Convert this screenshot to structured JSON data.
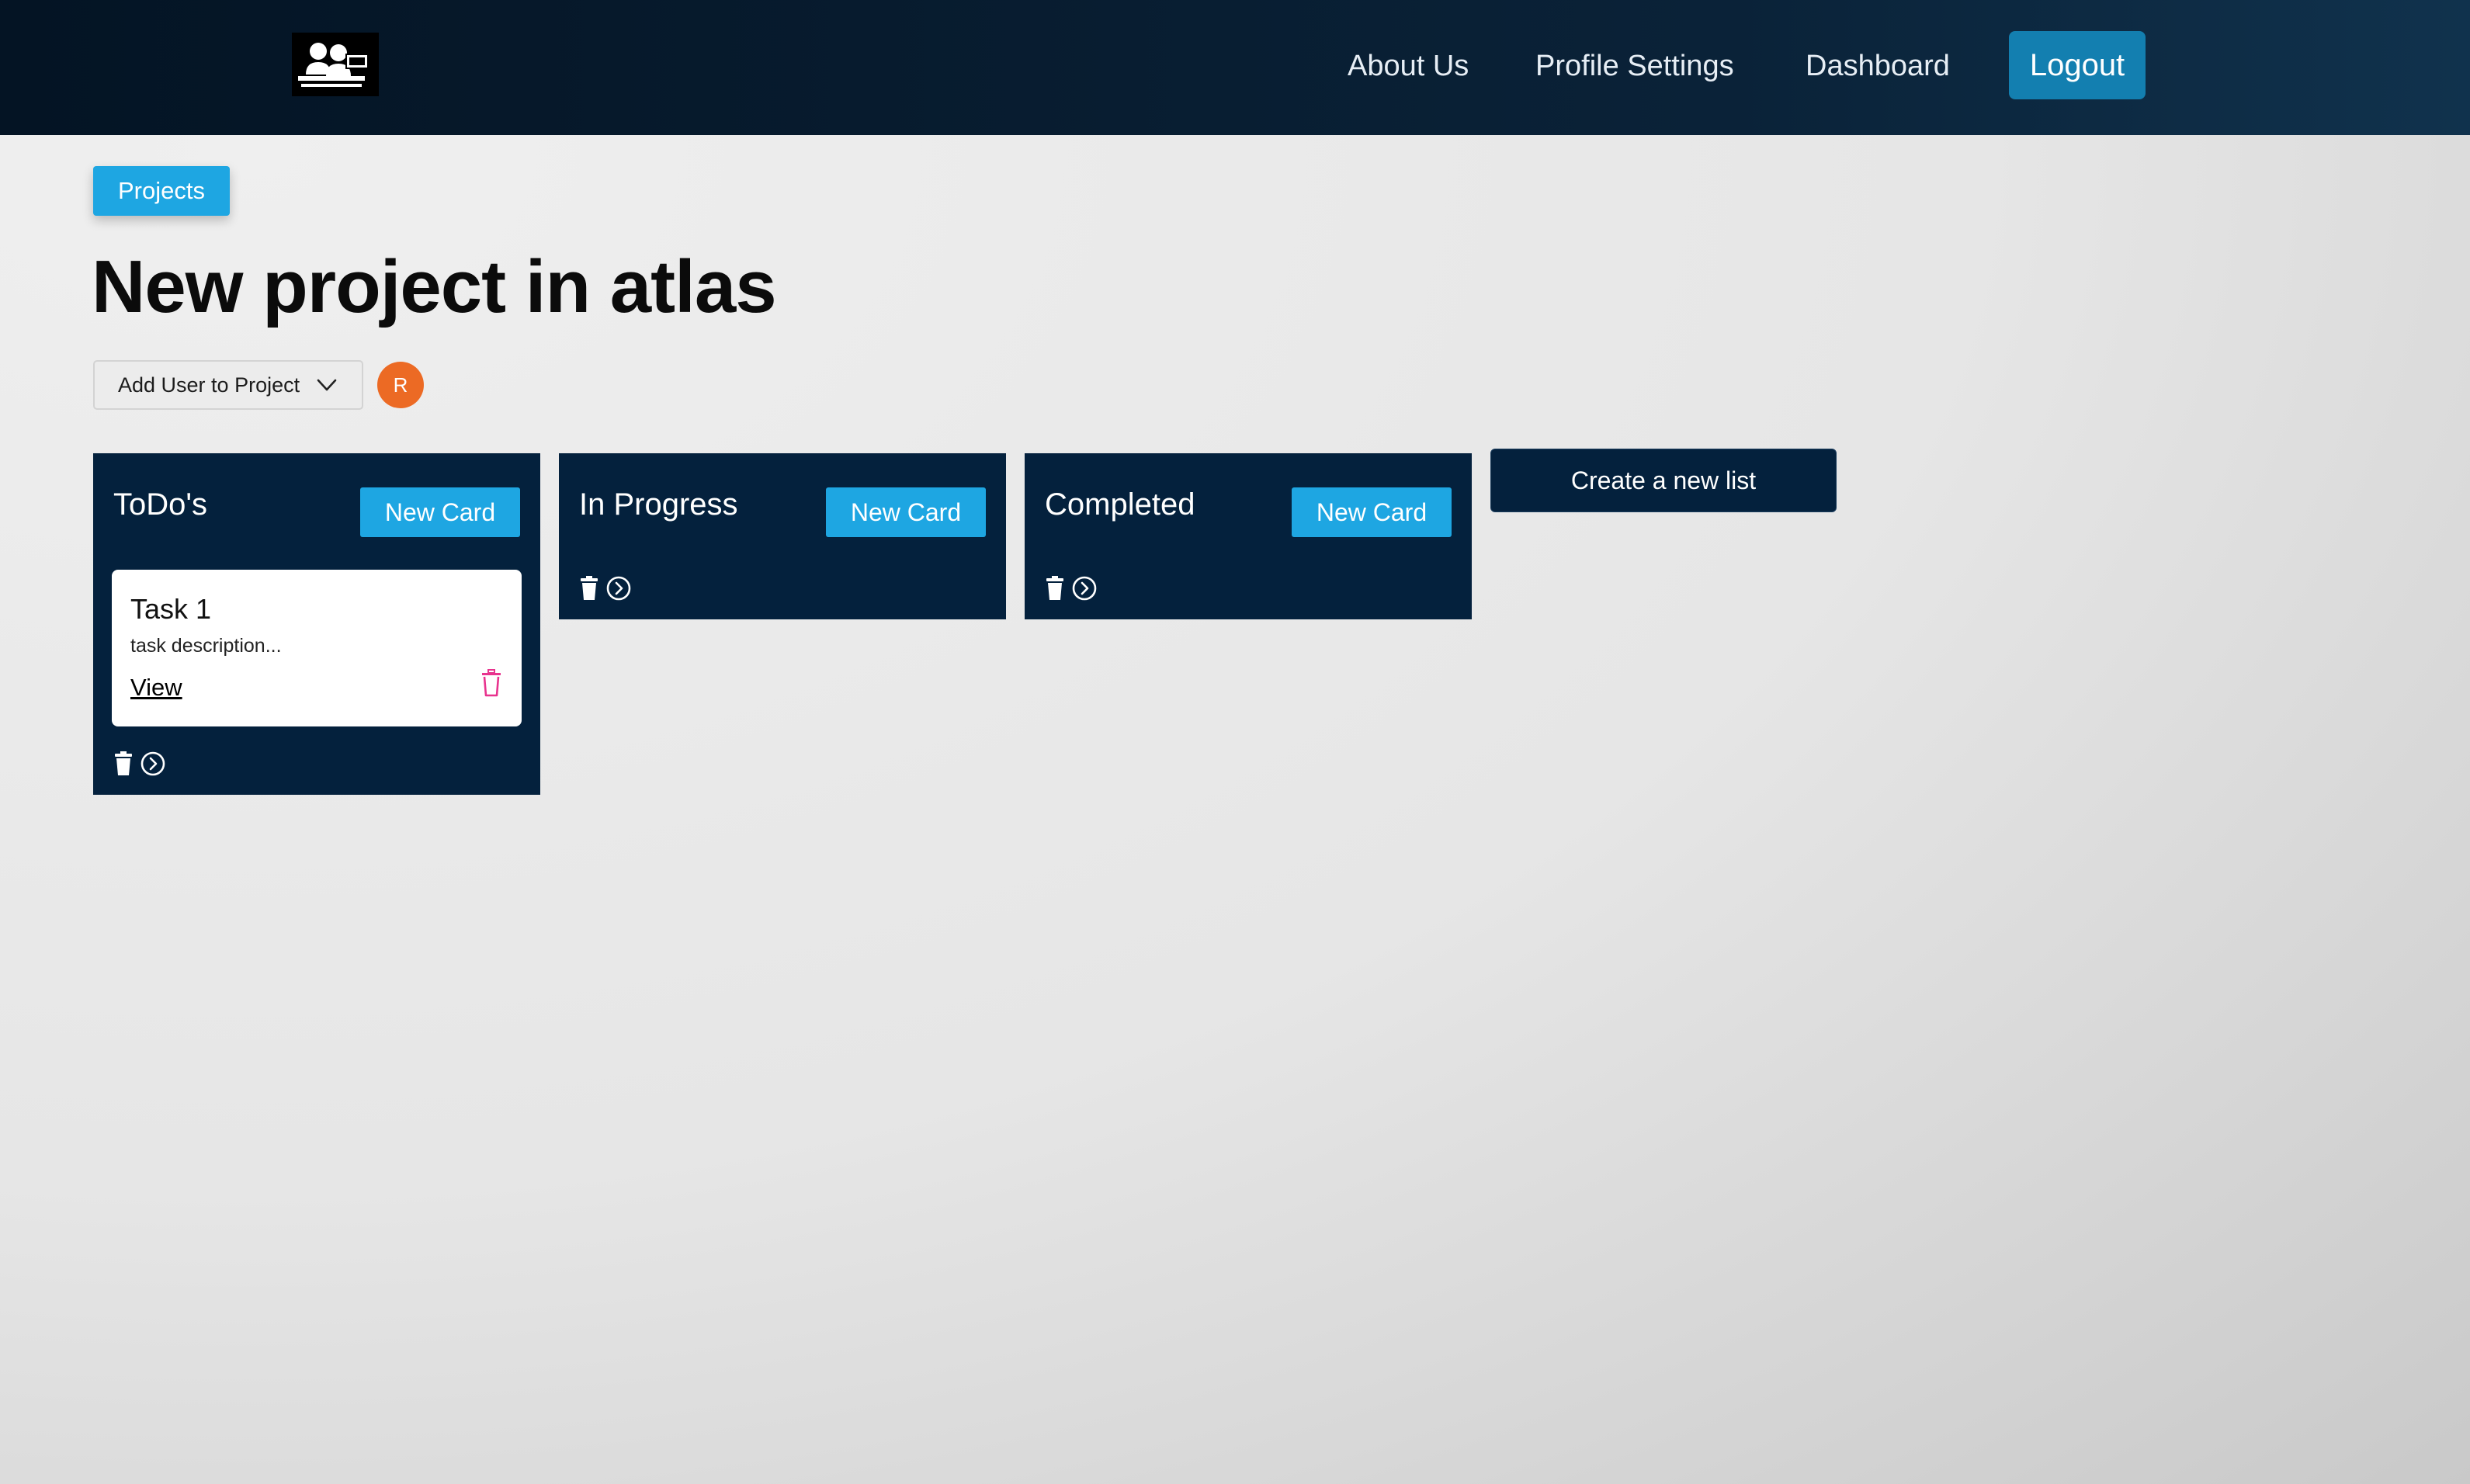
{
  "nav": {
    "logo_icon": "people-at-desk-logo",
    "links": [
      {
        "label": "About Us"
      },
      {
        "label": "Profile Settings"
      },
      {
        "label": "Dashboard"
      }
    ],
    "logout_label": "Logout"
  },
  "breadcrumb": {
    "label": "Projects"
  },
  "project": {
    "title": "New project in atlas",
    "add_user_label": "Add User to Project",
    "members": [
      {
        "initial": "R",
        "color": "#ec6a24"
      }
    ]
  },
  "lists": [
    {
      "title": "ToDo's",
      "new_card_label": "New Card",
      "cards": [
        {
          "title": "Task 1",
          "description": "task description...",
          "view_label": "View"
        }
      ]
    },
    {
      "title": "In Progress",
      "new_card_label": "New Card",
      "cards": []
    },
    {
      "title": "Completed",
      "new_card_label": "New Card",
      "cards": []
    }
  ],
  "create_list_label": "Create a new list",
  "colors": {
    "nav_bg": "#041424",
    "accent": "#1ea6e2",
    "logout": "#137fb0",
    "list_bg": "#04213d",
    "avatar": "#ec6a24",
    "delete": "#e8338e"
  }
}
